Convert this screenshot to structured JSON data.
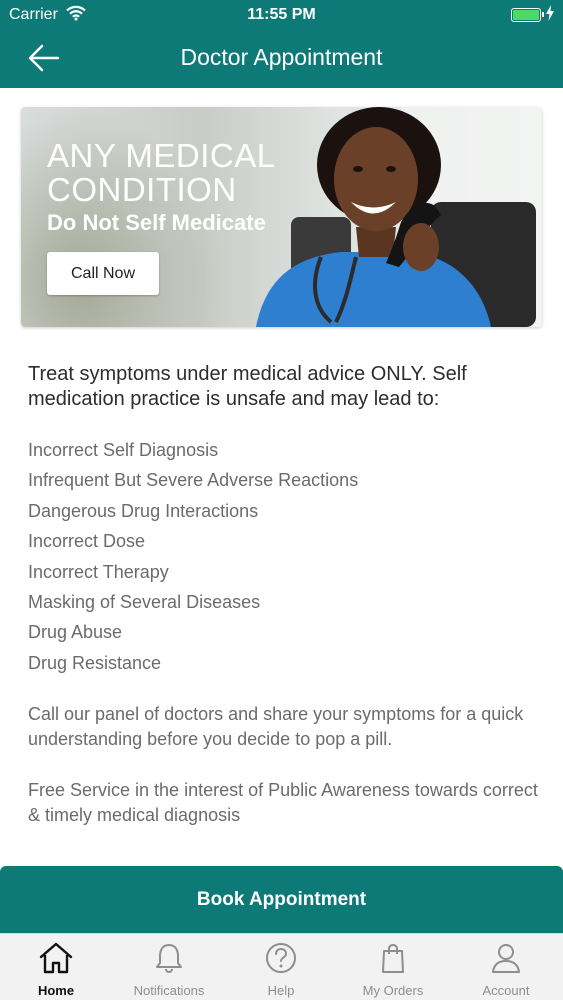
{
  "status_bar": {
    "carrier": "Carrier",
    "time": "11:55 PM",
    "icons": [
      "wifi-icon",
      "battery-icon",
      "charging-bolt-icon"
    ],
    "battery_color": "#4cd964"
  },
  "nav": {
    "title": "Doctor Appointment",
    "back_icon": "arrow-left-icon",
    "background": "#0e7a78"
  },
  "banner": {
    "line1": "ANY MEDICAL",
    "line2": "CONDITION",
    "tagline": "Do Not Self Medicate",
    "call_button": "Call Now"
  },
  "content": {
    "lead": "Treat symptoms under medical advice ONLY. Self medication practice is unsafe and may lead to:",
    "risks": [
      "Incorrect Self Diagnosis",
      "Infrequent But Severe Adverse Reactions",
      "Dangerous Drug Interactions",
      "Incorrect Dose",
      "Incorrect Therapy",
      "Masking of Several Diseases",
      "Drug Abuse",
      "Drug Resistance"
    ],
    "paragraph1": "Call our panel of doctors and share your symptoms for a quick understanding before you decide to pop a pill.",
    "paragraph2": "Free Service in the interest of Public Awareness towards correct & timely medical diagnosis"
  },
  "book_button": "Book Appointment",
  "tabs": [
    {
      "label": "Home",
      "icon": "home-icon",
      "active": true
    },
    {
      "label": "Notifications",
      "icon": "bell-icon",
      "active": false
    },
    {
      "label": "Help",
      "icon": "question-icon",
      "active": false
    },
    {
      "label": "My Orders",
      "icon": "shopping-bag-icon",
      "active": false
    },
    {
      "label": "Account",
      "icon": "user-icon",
      "active": false
    }
  ]
}
